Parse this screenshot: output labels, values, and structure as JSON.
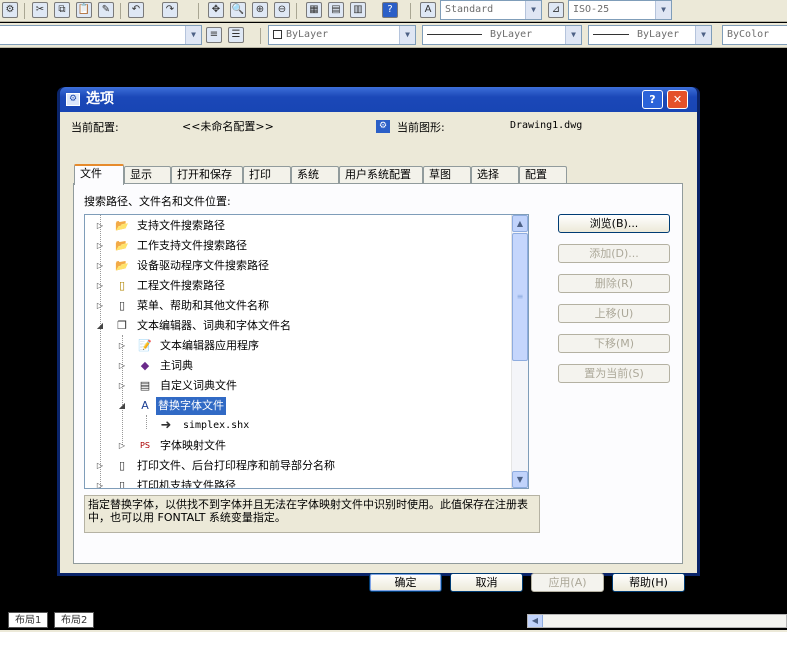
{
  "toolbar1": {
    "text_style": "Standard",
    "dim_style": "ISO-25"
  },
  "toolbar2": {
    "layer": "ByLayer",
    "linetype": "ByLayer",
    "lineweight": "ByLayer",
    "plotstyle": "ByColor"
  },
  "dialog": {
    "title": "选项",
    "help_btn": "?",
    "close_btn": "✕",
    "profile_label": "当前配置:",
    "profile_value": "<<未命名配置>>",
    "drawing_label": "当前图形:",
    "drawing_value": "Drawing1.dwg",
    "tabs": [
      "文件",
      "显示",
      "打开和保存",
      "打印",
      "系统",
      "用户系统配置",
      "草图",
      "选择",
      "配置"
    ],
    "section_label": "搜索路径、文件名和文件位置:",
    "tree": [
      {
        "label": "支持文件搜索路径",
        "icon": "folder-icon"
      },
      {
        "label": "工作支持文件搜索路径",
        "icon": "folder-icon"
      },
      {
        "label": "设备驱动程序文件搜索路径",
        "icon": "folder-icon"
      },
      {
        "label": "工程文件搜索路径",
        "icon": "project-icon"
      },
      {
        "label": "菜单、帮助和其他文件名称",
        "icon": "file-icon"
      },
      {
        "label": "文本编辑器、词典和字体文件名",
        "icon": "files-icon"
      },
      {
        "label": "文本编辑器应用程序",
        "icon": "editor-icon"
      },
      {
        "label": "主词典",
        "icon": "book-icon"
      },
      {
        "label": "自定义词典文件",
        "icon": "dictionary-file-icon"
      },
      {
        "label": "替换字体文件",
        "icon": "font-file-icon"
      },
      {
        "label": "simplex.shx",
        "icon": "arrow-icon"
      },
      {
        "label": "字体映射文件",
        "icon": "ps-file-icon"
      },
      {
        "label": "打印文件、后台打印程序和前导部分名称",
        "icon": "file-icon"
      },
      {
        "label": "打印机支持文件路径",
        "icon": "file-icon"
      }
    ],
    "side_buttons": {
      "browse": "浏览(B)...",
      "add": "添加(D)...",
      "remove": "删除(R)",
      "move_up": "上移(U)",
      "move_down": "下移(M)",
      "set_current": "置为当前(S)"
    },
    "description": "指定替换字体，以供找不到字体并且无法在字体映射文件中识别时使用。此值保存在注册表中，也可以用 FONTALT 系统变量指定。",
    "buttons": {
      "ok": "确定",
      "cancel": "取消",
      "apply": "应用(A)",
      "help": "帮助(H)"
    }
  },
  "layout_tabs": [
    "布局1",
    "布局2"
  ]
}
